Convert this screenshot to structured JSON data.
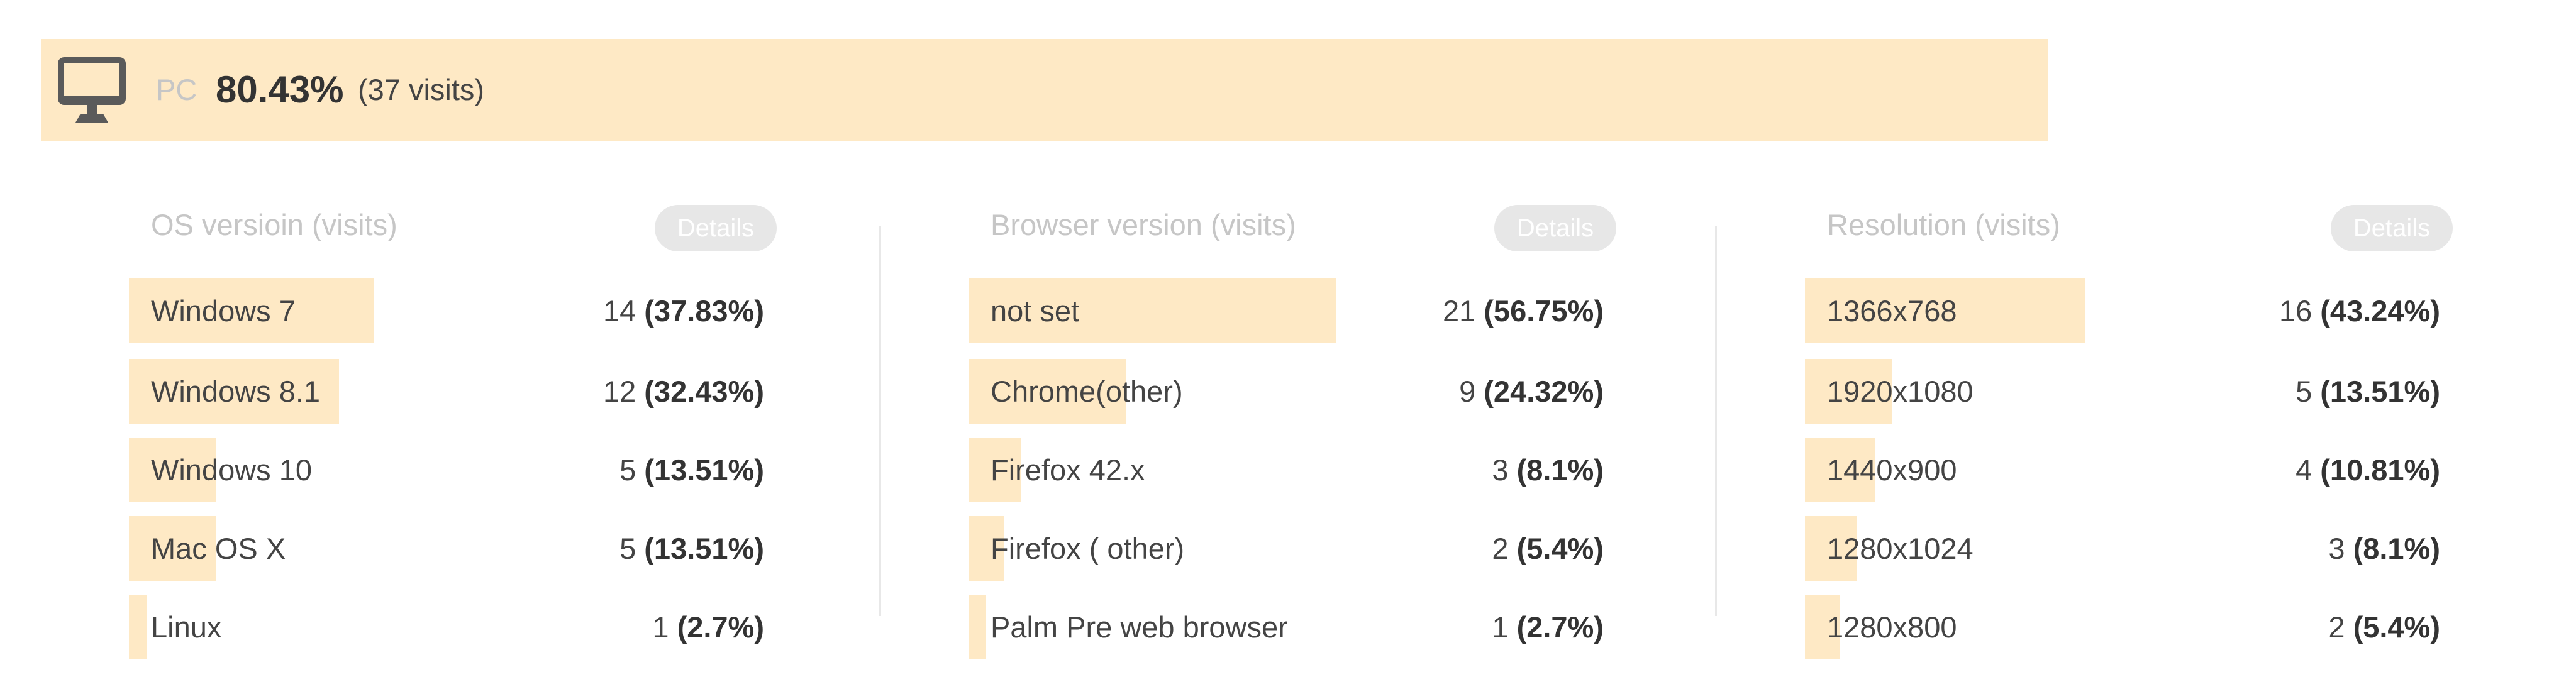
{
  "header": {
    "icon": "desktop-monitor-icon",
    "label": "PC",
    "percent": "80.43%",
    "visits": "(37 visits)"
  },
  "colors": {
    "bar": "#fee9c5",
    "details_bg": "#e7e7e7",
    "muted_text": "#c6c6c6",
    "text": "#444444"
  },
  "panels": [
    {
      "title": "OS versioin (visits)",
      "details_label": "Details",
      "rows": [
        {
          "label": "Windows 7",
          "count": "14",
          "pct": "(37.83%)",
          "share": 0.3783
        },
        {
          "label": "Windows 8.1",
          "count": "12",
          "pct": "(32.43%)",
          "share": 0.3243
        },
        {
          "label": "Windows 10",
          "count": "5",
          "pct": "(13.51%)",
          "share": 0.1351
        },
        {
          "label": "Mac OS X",
          "count": "5",
          "pct": "(13.51%)",
          "share": 0.1351
        },
        {
          "label": "Linux",
          "count": "1",
          "pct": "(2.7%)",
          "share": 0.027
        }
      ]
    },
    {
      "title": "Browser version (visits)",
      "details_label": "Details",
      "rows": [
        {
          "label": "not set",
          "count": "21",
          "pct": "(56.75%)",
          "share": 0.5675
        },
        {
          "label": "Chrome(other)",
          "count": "9",
          "pct": "(24.32%)",
          "share": 0.2432
        },
        {
          "label": "Firefox 42.x",
          "count": "3",
          "pct": "(8.1%)",
          "share": 0.081
        },
        {
          "label": "Firefox ( other)",
          "count": "2",
          "pct": "(5.4%)",
          "share": 0.054
        },
        {
          "label": "Palm Pre web browser",
          "count": "1",
          "pct": "(2.7%)",
          "share": 0.027
        }
      ]
    },
    {
      "title": "Resolution (visits)",
      "details_label": "Details",
      "rows": [
        {
          "label": "1366x768",
          "count": "16",
          "pct": "(43.24%)",
          "share": 0.4324
        },
        {
          "label": "1920x1080",
          "count": "5",
          "pct": "(13.51%)",
          "share": 0.1351
        },
        {
          "label": "1440x900",
          "count": "4",
          "pct": "(10.81%)",
          "share": 0.1081
        },
        {
          "label": "1280x1024",
          "count": "3",
          "pct": "(8.1%)",
          "share": 0.081
        },
        {
          "label": "1280x800",
          "count": "2",
          "pct": "(5.4%)",
          "share": 0.054
        }
      ]
    }
  ]
}
